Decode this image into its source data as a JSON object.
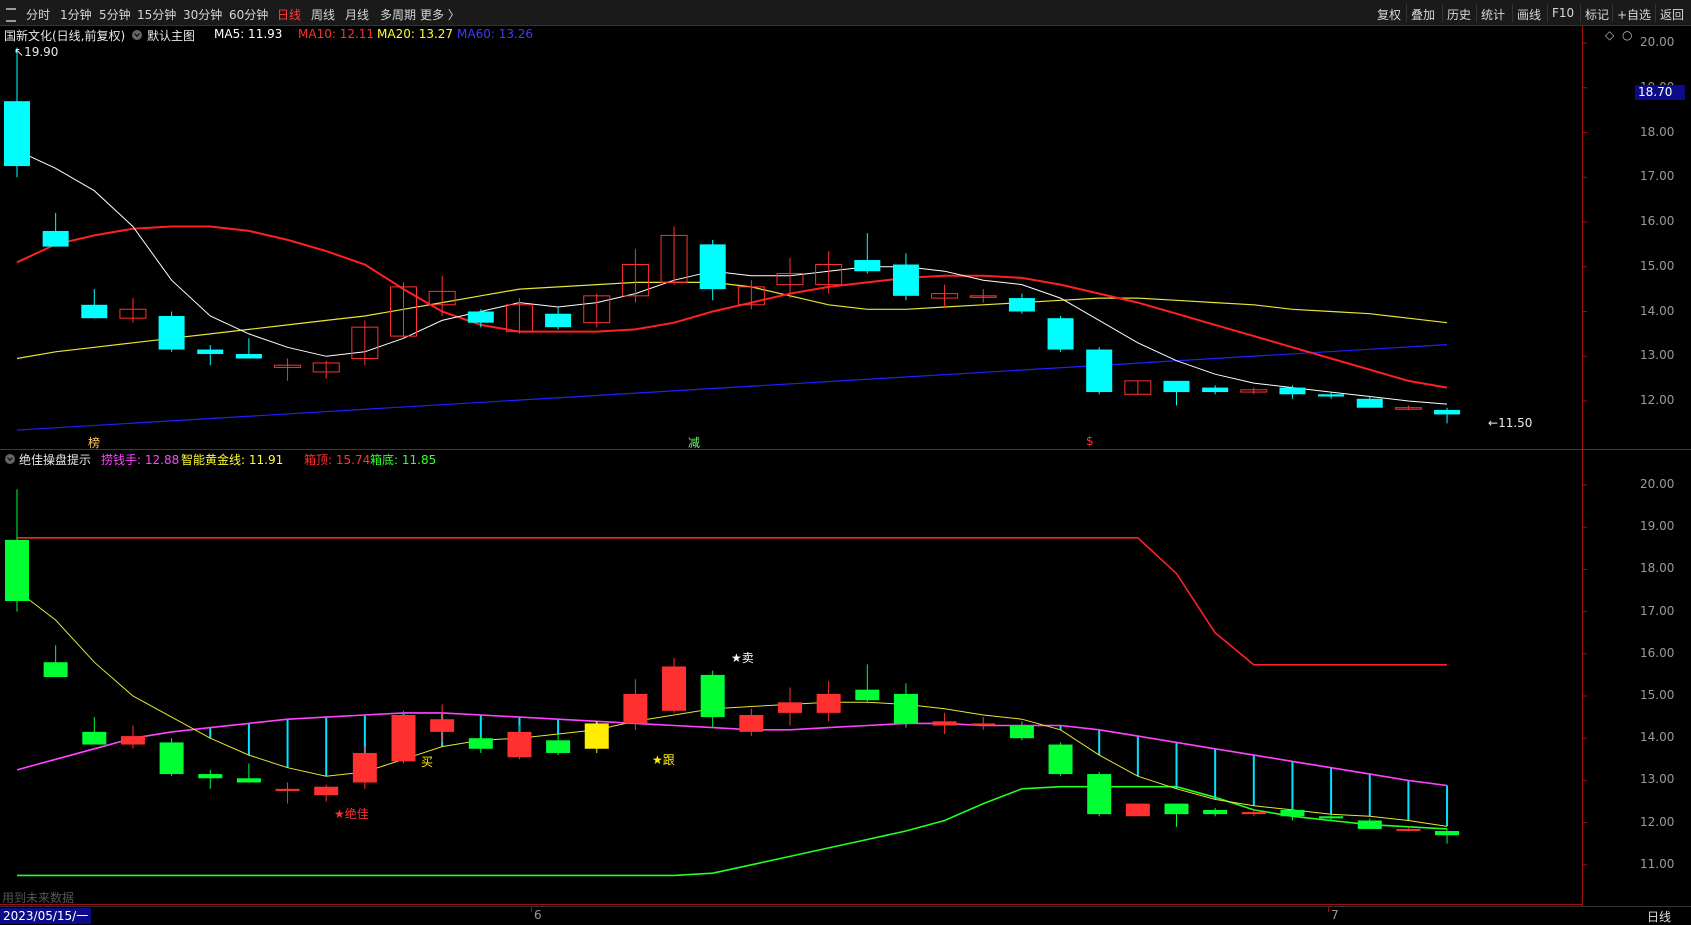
{
  "toolbar": {
    "timeframes": [
      "分时",
      "1分钟",
      "5分钟",
      "15分钟",
      "30分钟",
      "60分钟",
      "日线",
      "周线",
      "月线",
      "多周期",
      "更多 〉"
    ],
    "active_index": 6,
    "right_items": [
      "复权",
      "叠加",
      "历史",
      "统计",
      "画线",
      "F10",
      "标记",
      "+自选",
      "返回"
    ]
  },
  "main_panel": {
    "stock_name": "国新文化(日线,前复权)",
    "template": "默认主图",
    "ma": [
      {
        "label": "MA5: 11.93",
        "color": "#ffffff"
      },
      {
        "label": "MA10: 12.11",
        "color": "#ff3030"
      },
      {
        "label": "MA20: 13.27",
        "color": "#ffff33"
      },
      {
        "label": "MA60: 13.26",
        "color": "#3c3cff"
      }
    ],
    "high_label": "19.90",
    "low_label": "11.50",
    "current_price_tag": "18.70",
    "markers": [
      {
        "text": "榜",
        "color": "#ffcc66"
      },
      {
        "text": "减",
        "color": "#66ff66"
      },
      {
        "text": "$",
        "color": "#ff3030"
      }
    ],
    "icons": [
      "diamond-icon",
      "close-icon"
    ]
  },
  "sub_panel": {
    "title": "绝佳操盘提示",
    "values": [
      {
        "label": "捞钱手: 12.88",
        "color": "#ff44ff"
      },
      {
        "label": "智能黄金线: 11.91",
        "color": "#ffff33"
      },
      {
        "label": "箱顶: 15.74",
        "color": "#ff3030"
      },
      {
        "label": "箱底: 11.85",
        "color": "#33ff33"
      }
    ],
    "annotations": [
      {
        "text": "★卖",
        "color": "#ffffff"
      },
      {
        "text": "★跟",
        "color": "#ffee00"
      },
      {
        "text": "★绝佳",
        "color": "#ff3030"
      },
      {
        "text": "买",
        "color": "#ffee00"
      }
    ],
    "future_note": "用到未来数据"
  },
  "axis": {
    "main_ticks": [
      "20.00",
      "19.00",
      "18.00",
      "17.00",
      "16.00",
      "15.00",
      "14.00",
      "13.00",
      "12.00"
    ],
    "sub_ticks": [
      "20.00",
      "19.00",
      "18.00",
      "17.00",
      "16.00",
      "15.00",
      "14.00",
      "13.00",
      "12.00",
      "11.00"
    ],
    "date_label": "2023/05/15/一",
    "month_labels": [
      "6",
      "7"
    ],
    "period_label": "日线"
  },
  "colors": {
    "up": "#ff3030",
    "down_main": "#00ffff",
    "down_sub": "#00ff33",
    "ma5": "#ffffff",
    "ma10": "#ff2020",
    "ma20": "#e6e633",
    "ma60": "#2020ff",
    "box_top": "#ff2020",
    "box_bottom": "#22ff22",
    "gold": "#e6e633",
    "lqs": "#ff44ff",
    "stem": "#00e5ff"
  },
  "chart_data": {
    "type": "candlestick",
    "dates_note": "daily bars starting 2023/05/15",
    "candles": [
      [
        18.7,
        17.25,
        19.9,
        17.0
      ],
      [
        15.8,
        15.45,
        16.2,
        15.45
      ],
      [
        14.15,
        13.85,
        14.5,
        13.85
      ],
      [
        13.85,
        14.05,
        14.3,
        13.75
      ],
      [
        13.9,
        13.15,
        14.0,
        13.1
      ],
      [
        13.15,
        13.05,
        13.25,
        12.8
      ],
      [
        13.05,
        12.95,
        13.4,
        12.95
      ],
      [
        12.75,
        12.8,
        12.95,
        12.45
      ],
      [
        12.65,
        12.85,
        12.9,
        12.5
      ],
      [
        12.95,
        13.65,
        13.8,
        12.8
      ],
      [
        13.45,
        14.55,
        14.65,
        13.4
      ],
      [
        14.15,
        14.45,
        14.8,
        13.9
      ],
      [
        14.0,
        13.75,
        14.05,
        13.65
      ],
      [
        13.55,
        14.15,
        14.3,
        13.5
      ],
      [
        13.95,
        13.65,
        14.1,
        13.6
      ],
      [
        13.75,
        14.35,
        14.4,
        13.65
      ],
      [
        14.35,
        15.05,
        15.4,
        14.2
      ],
      [
        14.65,
        15.7,
        15.9,
        14.6
      ],
      [
        15.5,
        14.5,
        15.6,
        14.25
      ],
      [
        14.15,
        14.55,
        14.7,
        14.05
      ],
      [
        14.6,
        14.85,
        15.2,
        14.3
      ],
      [
        14.6,
        15.05,
        15.35,
        14.4
      ],
      [
        15.15,
        14.9,
        15.75,
        14.85
      ],
      [
        15.05,
        14.35,
        15.3,
        14.25
      ],
      [
        14.3,
        14.4,
        14.6,
        14.1
      ],
      [
        14.35,
        14.35,
        14.5,
        14.2
      ],
      [
        14.3,
        14.0,
        14.4,
        13.95
      ],
      [
        13.85,
        13.15,
        13.9,
        13.1
      ],
      [
        13.15,
        12.2,
        13.2,
        12.15
      ],
      [
        12.15,
        12.45,
        12.45,
        12.15
      ],
      [
        12.45,
        12.2,
        12.45,
        11.9
      ],
      [
        12.3,
        12.2,
        12.35,
        12.15
      ],
      [
        12.2,
        12.25,
        12.3,
        12.15
      ],
      [
        12.3,
        12.15,
        12.35,
        12.05
      ],
      [
        12.15,
        12.1,
        12.2,
        12.05
      ],
      [
        12.05,
        11.85,
        12.1,
        11.85
      ],
      [
        11.85,
        11.85,
        11.9,
        11.8
      ],
      [
        11.8,
        11.7,
        11.85,
        11.5
      ]
    ],
    "candle_fields": [
      "open",
      "close",
      "high",
      "low"
    ],
    "ma5": [
      17.6,
      17.2,
      16.7,
      15.9,
      14.7,
      13.9,
      13.5,
      13.2,
      13.0,
      13.1,
      13.4,
      13.8,
      14.0,
      14.2,
      14.1,
      14.2,
      14.4,
      14.7,
      14.9,
      14.8,
      14.8,
      14.9,
      15.0,
      15.0,
      14.9,
      14.7,
      14.6,
      14.3,
      13.8,
      13.3,
      12.9,
      12.6,
      12.4,
      12.3,
      12.2,
      12.1,
      12.0,
      11.93
    ],
    "ma10": [
      15.1,
      15.5,
      15.7,
      15.85,
      15.9,
      15.9,
      15.8,
      15.6,
      15.35,
      15.05,
      14.5,
      14.0,
      13.7,
      13.55,
      13.55,
      13.55,
      13.6,
      13.75,
      14.0,
      14.2,
      14.4,
      14.55,
      14.65,
      14.75,
      14.8,
      14.8,
      14.75,
      14.6,
      14.4,
      14.2,
      13.95,
      13.7,
      13.45,
      13.2,
      12.95,
      12.7,
      12.45,
      12.3,
      12.11
    ],
    "ma20": [
      12.95,
      13.1,
      13.2,
      13.3,
      13.4,
      13.5,
      13.6,
      13.7,
      13.8,
      13.9,
      14.05,
      14.2,
      14.35,
      14.5,
      14.55,
      14.6,
      14.65,
      14.65,
      14.65,
      14.55,
      14.35,
      14.15,
      14.05,
      14.05,
      14.1,
      14.15,
      14.2,
      14.25,
      14.3,
      14.3,
      14.25,
      14.2,
      14.15,
      14.05,
      14.0,
      13.95,
      13.85,
      13.75,
      13.6,
      13.27
    ],
    "ma60": [
      11.35,
      13.26
    ],
    "box_top": [
      18.75,
      18.75,
      18.75,
      18.75,
      18.75,
      18.75,
      18.75,
      18.75,
      18.75,
      18.75,
      18.75,
      18.75,
      18.75,
      18.75,
      18.75,
      18.75,
      18.75,
      18.75,
      18.75,
      18.75,
      18.75,
      18.75,
      18.75,
      18.75,
      18.75,
      18.75,
      18.75,
      18.75,
      18.75,
      18.75,
      17.9,
      16.5,
      15.74,
      15.74,
      15.74,
      15.74,
      15.74,
      15.74
    ],
    "box_bottom": [
      10.75,
      10.75,
      10.75,
      10.75,
      10.75,
      10.75,
      10.75,
      10.75,
      10.75,
      10.75,
      10.75,
      10.75,
      10.75,
      10.75,
      10.75,
      10.75,
      10.75,
      10.75,
      10.8,
      11.0,
      11.2,
      11.4,
      11.6,
      11.8,
      12.05,
      12.45,
      12.8,
      12.85,
      12.85,
      12.85,
      12.85,
      12.6,
      12.3,
      12.15,
      12.05,
      11.95,
      11.9,
      11.85
    ],
    "gold_line": [
      17.5,
      16.8,
      15.8,
      15.0,
      14.5,
      14.0,
      13.6,
      13.3,
      13.1,
      13.2,
      13.5,
      13.8,
      13.95,
      14.0,
      14.1,
      14.2,
      14.4,
      14.55,
      14.7,
      14.75,
      14.8,
      14.85,
      14.85,
      14.8,
      14.7,
      14.55,
      14.45,
      14.2,
      13.6,
      13.1,
      12.8,
      12.55,
      12.4,
      12.3,
      12.2,
      12.15,
      12.05,
      11.91
    ],
    "lqs": [
      13.25,
      13.5,
      13.75,
      14.0,
      14.15,
      14.25,
      14.35,
      14.45,
      14.5,
      14.55,
      14.6,
      14.6,
      14.55,
      14.5,
      14.45,
      14.4,
      14.35,
      14.3,
      14.25,
      14.2,
      14.2,
      14.25,
      14.3,
      14.35,
      14.35,
      14.3,
      14.3,
      14.3,
      14.2,
      14.05,
      13.9,
      13.75,
      13.6,
      13.45,
      13.3,
      13.15,
      13.0,
      12.88
    ],
    "main_ylim": [
      11.2,
      20.3
    ],
    "sub_ylim": [
      10.3,
      20.3
    ]
  }
}
